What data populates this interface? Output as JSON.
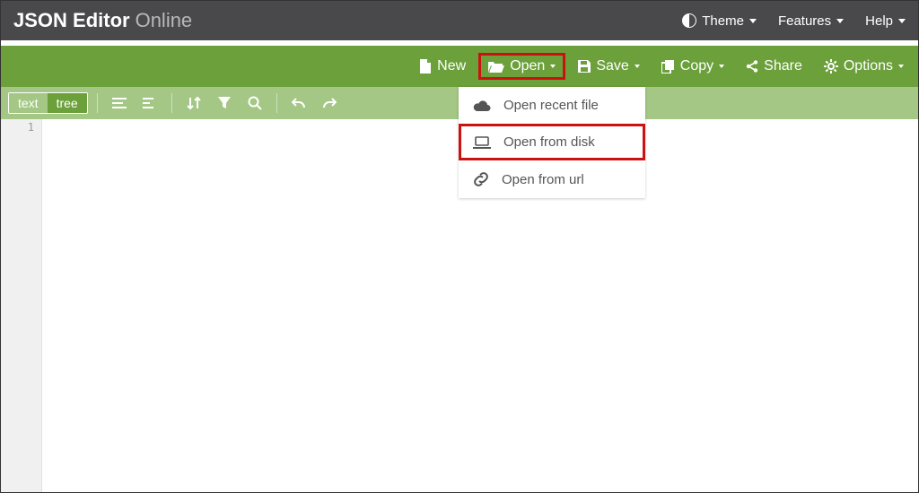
{
  "brand": {
    "bold": "JSON Editor",
    "light": "Online"
  },
  "topnav": {
    "theme": "Theme",
    "features": "Features",
    "help": "Help"
  },
  "actions": {
    "new": "New",
    "open": "Open",
    "save": "Save",
    "copy": "Copy",
    "share": "Share",
    "options": "Options"
  },
  "modes": {
    "text": "text",
    "tree": "tree"
  },
  "dropdown": {
    "recent": "Open recent file",
    "disk": "Open from disk",
    "url": "Open from url"
  },
  "lineno": "1"
}
